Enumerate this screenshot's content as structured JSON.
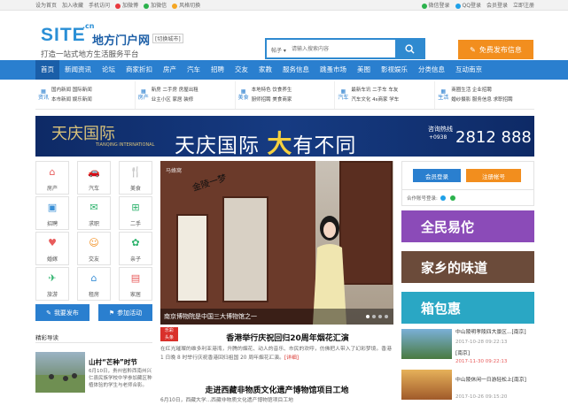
{
  "topbar": {
    "set_home": "设为首页",
    "add_fav": "加入收藏",
    "mobile": "手机访问",
    "weibo": "加微博",
    "wechat": "加微信",
    "style": "风格切换",
    "wechat_login": "微信登录",
    "qq_login": "QQ登录",
    "member_login": "会员登录",
    "register": "立即注册"
  },
  "header": {
    "logo": "SITE",
    "logo_cn": ".cn",
    "site_name": "地方门户网",
    "city_switch": "[切换城市]",
    "slogan": "打造一站式地方生活服务平台",
    "search_cat": "帖子",
    "search_placeholder": "请输入搜索内容",
    "post_button": "免费发布信息"
  },
  "nav": [
    "首页",
    "新闻资讯",
    "论坛",
    "商家折扣",
    "房产",
    "汽车",
    "招聘",
    "交友",
    "家教",
    "服务信息",
    "跳蚤市场",
    "美图",
    "影视娱乐",
    "分类信息",
    "互动南京"
  ],
  "subnav": [
    {
      "icon": "资讯",
      "rows": [
        "国内新闻 国际新闻",
        "本市新闻 娱乐新闻"
      ]
    },
    {
      "icon": "房产",
      "rows": [
        "新房 二手房 房屋出租",
        "业主小区 家居 装修"
      ]
    },
    {
      "icon": "美食",
      "rows": [
        "本地特色 饮食养生",
        "厨师招聘 美食商家"
      ]
    },
    {
      "icon": "汽车",
      "rows": [
        "最新车讯 二手车 车友",
        "汽车文化 4s商家 学车"
      ]
    },
    {
      "icon": "生活",
      "rows": [
        "商圈生活 企业招聘",
        "婚纱摄影 服务信息 求职招聘"
      ]
    }
  ],
  "banner": {
    "logo_text": "天庆国际",
    "logo_sub": "TIANQING INTERNATIONAL",
    "main_1": "天庆国际 ",
    "main_2": "大",
    "main_3": "有不同",
    "hotline": "咨询热线",
    "tel_prefix": "+0938",
    "tel": "2812 888"
  },
  "grid": [
    {
      "label": "房产",
      "icon": "⌂",
      "color": "#e85c5c"
    },
    {
      "label": "汽车",
      "icon": "🚗",
      "color": "#3a8fd6"
    },
    {
      "label": "美食",
      "icon": "🍴",
      "color": "#f28e1e"
    },
    {
      "label": "招聘",
      "icon": "▣",
      "color": "#3a8fd6"
    },
    {
      "label": "求职",
      "icon": "✉",
      "color": "#2bb26b"
    },
    {
      "label": "二手",
      "icon": "⊞",
      "color": "#2bb26b"
    },
    {
      "label": "婚嫁",
      "icon": "♥",
      "color": "#e85c5c"
    },
    {
      "label": "交友",
      "icon": "☺",
      "color": "#f28e1e"
    },
    {
      "label": "亲子",
      "icon": "✿",
      "color": "#2bb26b"
    },
    {
      "label": "旅游",
      "icon": "✈",
      "color": "#2bb26b"
    },
    {
      "label": "租房",
      "icon": "⌂",
      "color": "#3a8fd6"
    },
    {
      "label": "家居",
      "icon": "▤",
      "color": "#e85c5c"
    }
  ],
  "left_buttons": {
    "publish": "我要发布",
    "activity": "参加活动"
  },
  "slider": {
    "caption": "南京博物院是中国三大博物馆之一",
    "title_text": "金陵一梦",
    "watermark": "马蜂窝"
  },
  "right": {
    "login": "会员登录",
    "register": "注册帐号",
    "third_party": "合作账号登录:"
  },
  "ads": [
    {
      "text": "全民易佗",
      "bg": "#8b4bb8"
    },
    {
      "text": "家乡的味道",
      "bg": "#6b4b3a"
    },
    {
      "text": "箱包惠",
      "bg": "#2aa7c4"
    }
  ],
  "section_title": "精彩导读",
  "news": [
    {
      "title": "香港举行庆祝回归20周年烟花汇演",
      "body": "在红光璀璨的维多利亚港湾，升腾的烟花、动人的音乐、市民的欢呼，仿佛把人带入了幻彩梦境。香港 1 日晚 8 时举行庆祝香港回归祖国 20 周年烟花汇演。",
      "more": "[详细]"
    },
    {
      "title": "走进西藏非物质文化遗产博物馆项目工地",
      "body": "6月10日，西藏大学...西藏非物质文化遗产博物馆项目工地"
    }
  ],
  "feature": {
    "title": "山村“芒种”时节",
    "body": "6月10日，贵州省黔西南州兴仁县民族学校中学参加藏区种植体验的学生与老师合影。"
  },
  "side_news": [
    {
      "title": "中山陵明孝陵四大景区...[南京]",
      "date": "2017-10-28 09:22:13"
    },
    {
      "title": "[南京]",
      "date": "2017-11-30 09:22:13"
    },
    {
      "title": "中山陵休闲一日游轻松上[南京]",
      "date": "2017-10-26 09:15:20"
    }
  ],
  "lotto_label": "乐彩",
  "toutiao_label": "头条"
}
